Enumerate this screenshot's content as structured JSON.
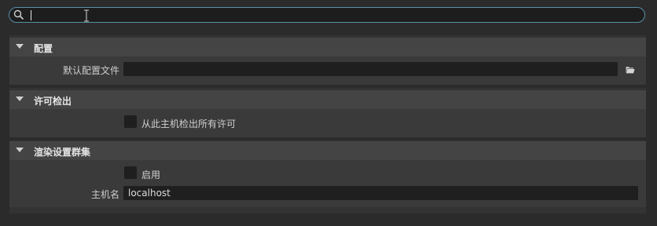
{
  "search": {
    "value": "",
    "placeholder": ""
  },
  "sections": {
    "config": {
      "title": "配置",
      "default_config_label": "默认配置文件",
      "default_config_value": ""
    },
    "license": {
      "title": "许可检出",
      "checkout_all_label": "从此主机检出所有许可",
      "checkout_all_checked": false
    },
    "render_cluster": {
      "title": "渲染设置群集",
      "enable_label": "启用",
      "enable_checked": false,
      "hostname_label": "主机名",
      "hostname_value": "localhost"
    }
  },
  "icons": {
    "search": "search-icon",
    "folder": "folder-open-icon",
    "collapse": "triangle-down-icon",
    "cursor": "text-cursor-icon"
  },
  "colors": {
    "search_border": "#5a8fa8",
    "header_bg": "#444444",
    "body_bg": "#3a3a3a",
    "field_bg": "#1f1f1f"
  }
}
